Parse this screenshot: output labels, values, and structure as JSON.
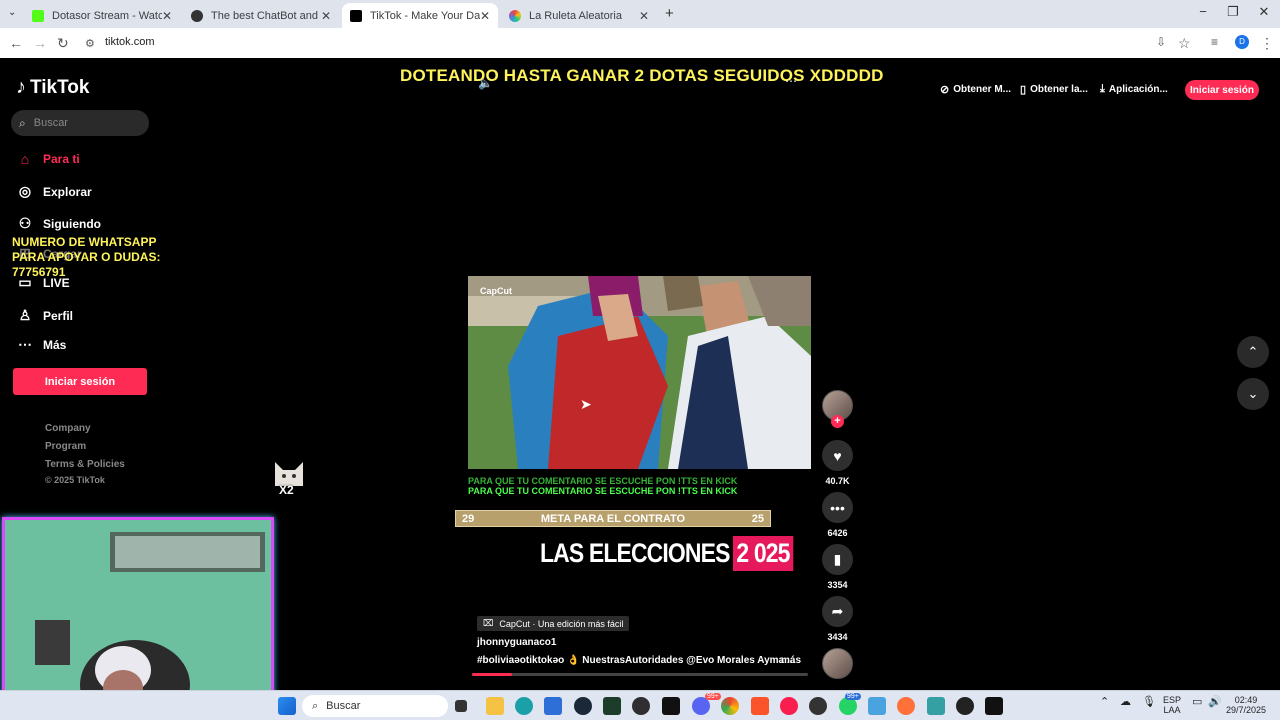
{
  "browser": {
    "tabs": [
      {
        "title": "Dotasor Stream - Watch Live o",
        "favicon_color": "#53fc18",
        "active": false
      },
      {
        "title": "The best ChatBot and Widgets",
        "favicon_color": "#333333",
        "active": false
      },
      {
        "title": "TikTok - Make Your Day",
        "favicon_color": "#000000",
        "active": true
      },
      {
        "title": "La Ruleta Aleatoria",
        "favicon_color": "#9b59b6",
        "active": false
      }
    ],
    "url": "tiktok.com"
  },
  "tiktok": {
    "logo": "TikTok",
    "search_placeholder": "Buscar",
    "nav": [
      {
        "label": "Para ti",
        "icon": "home-icon",
        "active": true
      },
      {
        "label": "Explorar",
        "icon": "compass-icon"
      },
      {
        "label": "Siguiendo",
        "icon": "following-icon"
      },
      {
        "label": "Cargar",
        "icon": "upload-icon"
      },
      {
        "label": "LIVE",
        "icon": "live-icon"
      },
      {
        "label": "Perfil",
        "icon": "profile-icon"
      },
      {
        "label": "Más",
        "icon": "more-icon"
      }
    ],
    "login_label": "Iniciar sesión",
    "footer": [
      "Company",
      "Program",
      "Terms & Policies",
      "© 2025 TikTok"
    ],
    "top_actions": [
      "Obtener M...",
      "Obtener la...",
      "Aplicación..."
    ],
    "top_login": "Iniciar sesión",
    "video": {
      "author": "jhonnyguanaco1",
      "caption": "#boliviaəotiktokəo 👌 NuestrasAutoridades  @Evo Morales Ayma ...",
      "more": "más",
      "capcut": "CapCut · Una edición más fácil",
      "election_text": "LAS ELECCIONES",
      "election_year": "2 025",
      "progress": 0.12
    },
    "actions": {
      "likes": "40.7K",
      "comments": "6426",
      "saves": "3354",
      "shares": "3434"
    }
  },
  "overlay": {
    "title": "DOTEANDO HASTA GANAR 2 DOTAS SEGUIDOS XDDDDD",
    "whatsapp": "NUMERO DE WHATSAPP PARA APOYAR O DUDAS: 77756791",
    "tts_line1": "PARA QUE TU COMENTARIO SE ESCUCHE PON !TTS EN KICK",
    "tts_line2": "PARA QUE TU COMENTARIO SE ESCUCHE PON !TTS EN KICK",
    "goal_left": "29",
    "goal_label": "META PARA EL CONTRATO",
    "goal_right": "25",
    "cat_label": "X2"
  },
  "taskbar": {
    "search": "Buscar",
    "lang": "ESP",
    "lang2": "LAA",
    "time": "02:49",
    "date": "29/7/2025",
    "badge1": "99+",
    "badge2": "99+"
  }
}
